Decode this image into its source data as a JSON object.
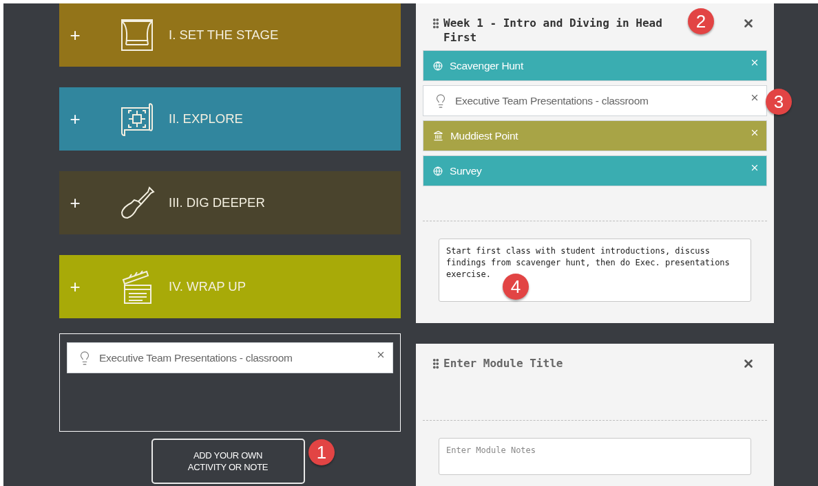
{
  "categories": [
    {
      "toggle": "+",
      "label": "I. SET THE STAGE",
      "kind": "stage",
      "color": "#937419"
    },
    {
      "toggle": "+",
      "label": "II. EXPLORE",
      "kind": "explore",
      "color": "#31869e"
    },
    {
      "toggle": "+",
      "label": "III. DIG DEEPER",
      "kind": "dig",
      "color": "#4a442d"
    },
    {
      "toggle": "+",
      "label": "IV. WRAP UP",
      "kind": "wrap",
      "color": "#a8aa08"
    }
  ],
  "dropzone": {
    "activities": [
      {
        "label": "Executive Team Presentations - classroom",
        "kind": "idea",
        "color": "#ffffff"
      }
    ]
  },
  "add_button": {
    "label": "ADD YOUR OWN ACTIVITY OR NOTE"
  },
  "modules": [
    {
      "title": "Week 1 - Intro and Diving in Head First",
      "title_placeholder": false,
      "activities": [
        {
          "label": "Scavenger Hunt",
          "kind": "web",
          "color": "#3aadb1"
        },
        {
          "label": "Executive Team Presentations - classroom",
          "kind": "idea",
          "color": "#ffffff"
        },
        {
          "label": "Muddiest Point",
          "kind": "assessment",
          "color": "#a8a446"
        },
        {
          "label": "Survey",
          "kind": "web",
          "color": "#3aadb1"
        }
      ],
      "notes": {
        "value": "Start first class with student introductions, discuss findings from scavenger hunt, then do Exec. presentations exercise."
      }
    },
    {
      "title": "Enter Module Title",
      "title_placeholder": true,
      "notes": {
        "placeholder": "Enter Module Notes"
      }
    }
  ],
  "callouts": [
    {
      "label": "1"
    },
    {
      "label": "2"
    },
    {
      "label": "3"
    },
    {
      "label": "4"
    }
  ]
}
